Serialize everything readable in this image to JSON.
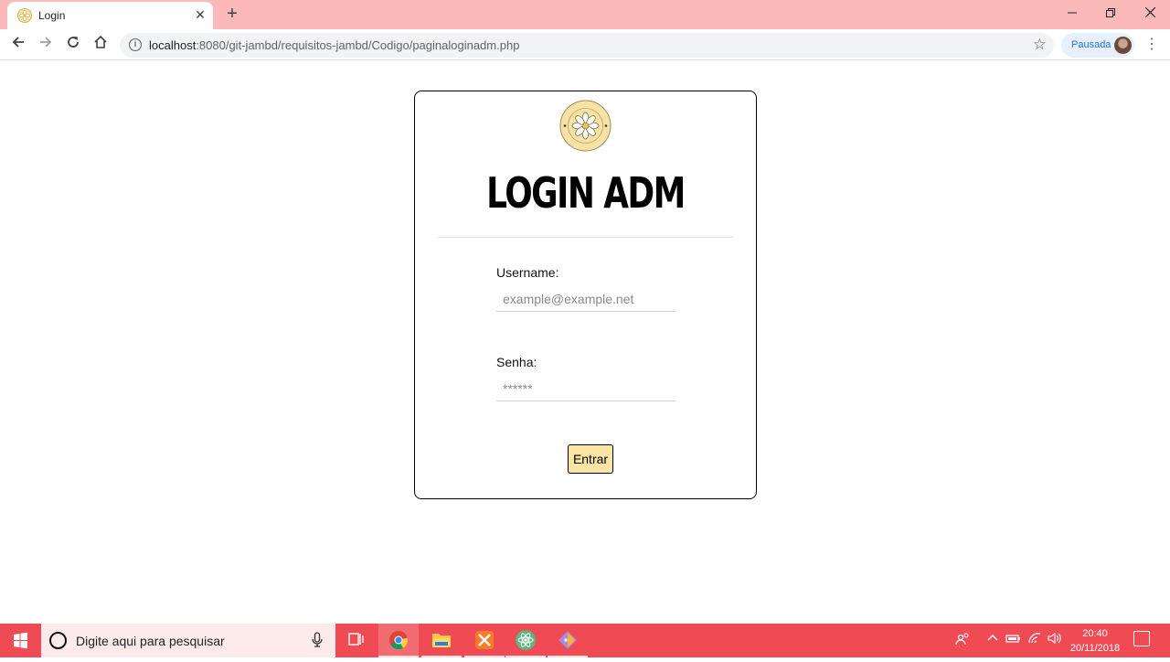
{
  "browser": {
    "tab_title": "Login",
    "tab_close": "✕",
    "new_tab": "+",
    "url_host": "localhost",
    "url_path": ":8080/git-jambd/requisitos-jambd/Codigo/paginaloginadm.php",
    "profile_label": "Pausada",
    "window_controls": [
      "minimize",
      "restore",
      "close"
    ],
    "nav_icons": [
      "back-icon",
      "forward-icon",
      "reload-icon",
      "home-icon"
    ]
  },
  "page": {
    "heading": "LOGIN ADM",
    "logo_text": "all for one",
    "username_label": "Username:",
    "username_placeholder": "example@example.net",
    "password_label": "Senha:",
    "password_placeholder": "******",
    "submit_label": "Entrar",
    "accent_color": "#fbe5a3"
  },
  "taskbar": {
    "search_placeholder": "Digite aqui para pesquisar",
    "apps": [
      "task-view",
      "chrome",
      "file-explorer",
      "xampp",
      "atom",
      "git"
    ],
    "time": "20:40",
    "date": "20/11/2018"
  },
  "colors": {
    "titlebar": "#fbb9b9",
    "taskbar": "#f04a55"
  }
}
